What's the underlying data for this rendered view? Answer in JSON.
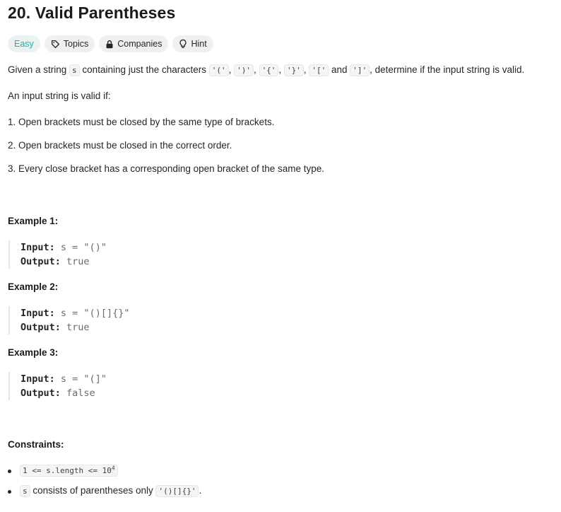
{
  "problem": {
    "title": "20. Valid Parentheses",
    "tags": {
      "difficulty": "Easy",
      "topics": "Topics",
      "companies": "Companies",
      "hint": "Hint"
    },
    "description": {
      "intro_1": "Given a string ",
      "s": "s",
      "intro_2": " containing just the characters ",
      "c1": "'('",
      "c2": "')'",
      "c3": "'{'",
      "c4": "'}'",
      "c5": "'['",
      "and": " and ",
      "c6": "']'",
      "intro_3": ", determine if the input string is valid.",
      "valid_if": "An input string is valid if:",
      "rules": [
        "1. Open brackets must be closed by the same type of brackets.",
        "2. Open brackets must be closed in the correct order.",
        "3. Every close bracket has a corresponding open bracket of the same type."
      ]
    },
    "examples": [
      {
        "heading": "Example 1:",
        "input_label": "Input:",
        "input": "s = \"()\"",
        "output_label": "Output:",
        "output": "true"
      },
      {
        "heading": "Example 2:",
        "input_label": "Input:",
        "input": "s = \"()[]{}\"",
        "output_label": "Output:",
        "output": "true"
      },
      {
        "heading": "Example 3:",
        "input_label": "Input:",
        "input": "s = \"(]\"",
        "output_label": "Output:",
        "output": "false"
      }
    ],
    "constraints": {
      "heading": "Constraints:",
      "c1_code": "1 <= s.length <= 10",
      "c1_sup": "4",
      "c2_s": "s",
      "c2_text": " consists of parentheses only ",
      "c2_code": "'()[]{}'",
      "c2_end": "."
    }
  }
}
